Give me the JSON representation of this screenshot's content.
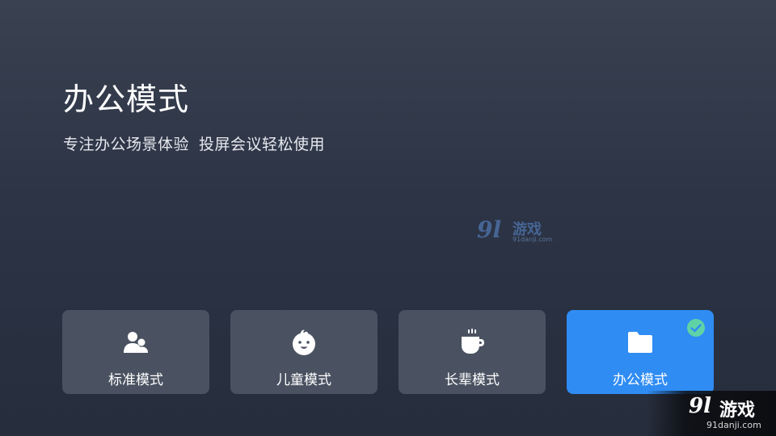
{
  "header": {
    "title": "办公模式",
    "subtitle_part1": "专注办公场景体验",
    "subtitle_part2": "投屏会议轻松使用"
  },
  "modes": [
    {
      "label": "标准模式",
      "icon": "users-icon",
      "selected": false
    },
    {
      "label": "儿童模式",
      "icon": "baby-face-icon",
      "selected": false
    },
    {
      "label": "长辈模式",
      "icon": "tea-cup-icon",
      "selected": false
    },
    {
      "label": "办公模式",
      "icon": "folder-icon",
      "selected": true
    }
  ],
  "selected_check_icon": "check-circle-icon",
  "watermark": {
    "number": "9l",
    "brand": "游戏",
    "url": "91danji.com"
  },
  "colors": {
    "background_top": "#3a4251",
    "background_bottom": "#262d3c",
    "card": "#4a5261",
    "card_selected": "#2f8cf3",
    "check": "#5fd3a6"
  }
}
